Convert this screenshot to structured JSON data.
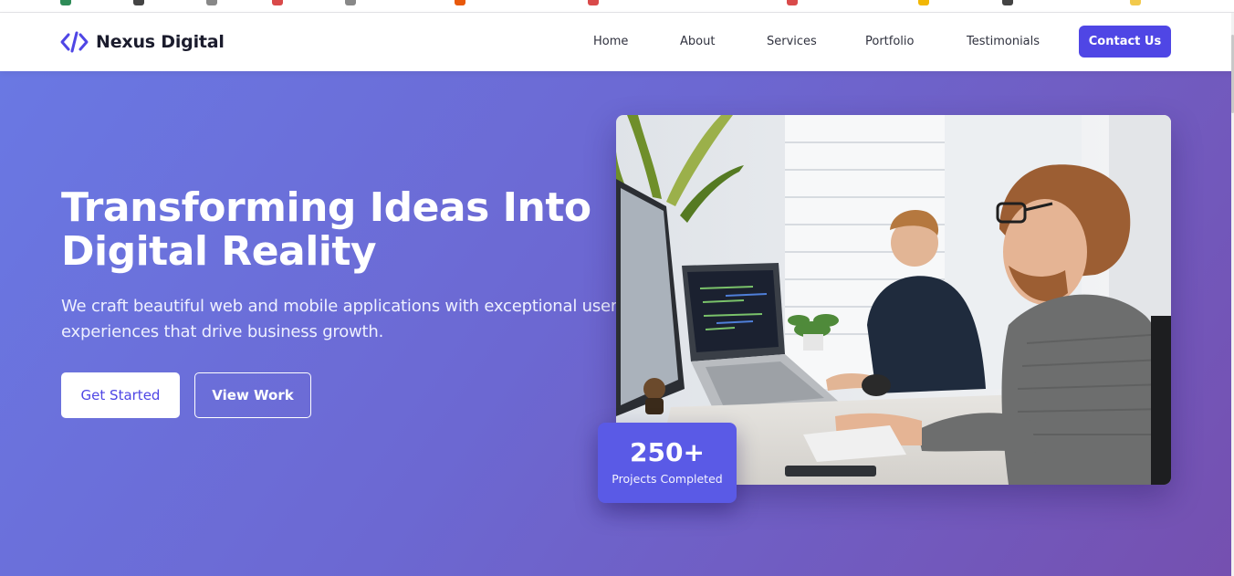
{
  "brand": {
    "name": "Nexus Digital",
    "logo_icon": "code-brackets-icon",
    "accent_color": "#4f46e5"
  },
  "nav": {
    "items": [
      {
        "label": "Home"
      },
      {
        "label": "About"
      },
      {
        "label": "Services"
      },
      {
        "label": "Portfolio"
      },
      {
        "label": "Testimonials"
      }
    ],
    "cta_label": "Contact Us"
  },
  "hero": {
    "title": "Transforming Ideas Into Digital Reality",
    "subtitle": "We craft beautiful web and mobile applications with exceptional user experiences that drive business growth.",
    "primary_button": "Get Started",
    "secondary_button": "View Work",
    "image_subject": "office-photo",
    "gradient_start": "#6a78e3",
    "gradient_end": "#7550b0"
  },
  "stat": {
    "number": "250+",
    "label": "Projects Completed",
    "color": "#5a5ae6"
  }
}
